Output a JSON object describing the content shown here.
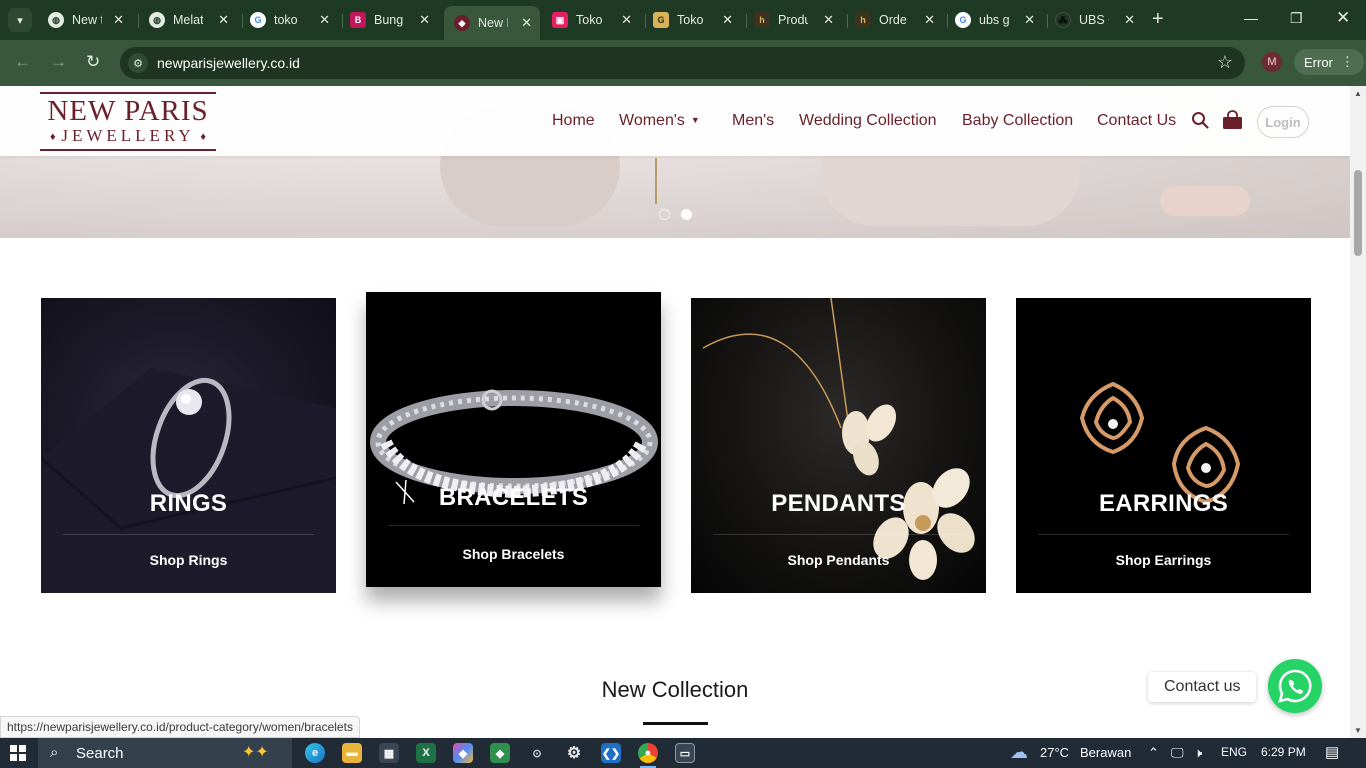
{
  "browser": {
    "tabs": [
      {
        "title": "New t",
        "favicon": "globe-icon",
        "fav_bg": "#e3ebe3",
        "fav_fg": "#1f3a24"
      },
      {
        "title": "Melat",
        "favicon": "globe-icon",
        "fav_bg": "#e3ebe3",
        "fav_fg": "#1f3a24"
      },
      {
        "title": "toko",
        "favicon": "google-icon",
        "fav_bg": "#ffffff",
        "fav_fg": "#4285f4"
      },
      {
        "title": "Bungi",
        "favicon": "bungi-icon",
        "fav_bg": "#c2185b",
        "fav_fg": "#ffffff"
      },
      {
        "title": "New P",
        "favicon": "newparis-icon",
        "fav_bg": "#6b1f2b",
        "fav_fg": "#ffffff"
      },
      {
        "title": "Toko",
        "favicon": "toko-pink-icon",
        "fav_bg": "#e91e63",
        "fav_fg": "#ffffff"
      },
      {
        "title": "Toko",
        "favicon": "toko-gold-icon",
        "fav_bg": "#d9b25a",
        "fav_fg": "#3a2a00"
      },
      {
        "title": "Produ",
        "favicon": "hala-gold-icon",
        "fav_bg": "#3b3320",
        "fav_fg": "#d9b25a"
      },
      {
        "title": "Orde",
        "favicon": "hala-gold-icon",
        "fav_bg": "#3b3320",
        "fav_fg": "#d9b25a"
      },
      {
        "title": "ubs g",
        "favicon": "google-icon",
        "fav_bg": "#ffffff",
        "fav_fg": "#4285f4"
      },
      {
        "title": "UBS C",
        "favicon": "ubs-icon",
        "fav_bg": "#1f3a24",
        "fav_fg": "#000000"
      }
    ],
    "active_tab_index": 4,
    "url": "newparisjewellery.co.id",
    "profile_initial": "M",
    "error_label": "Error"
  },
  "site": {
    "logo_line1": "NEW PARIS",
    "logo_line2": "JEWELLERY",
    "nav": {
      "home": "Home",
      "womens": "Women's",
      "mens": "Men's",
      "wedding": "Wedding Collection",
      "baby": "Baby Collection",
      "contact": "Contact Us"
    },
    "login": "Login",
    "slider_dots": 2,
    "slider_active": 2
  },
  "categories": [
    {
      "title": "RINGS",
      "link": "Shop Rings"
    },
    {
      "title": "BRACELETS",
      "link": "Shop Bracelets"
    },
    {
      "title": "PENDANTS",
      "link": "Shop Pendants"
    },
    {
      "title": "EARRINGS",
      "link": "Shop Earrings"
    }
  ],
  "section_title": "New Collection",
  "contact_us": "Contact us",
  "status_url": "https://newparisjewellery.co.id/product-category/women/bracelets",
  "taskbar": {
    "search": "Search",
    "weather_temp": "27°C",
    "weather_desc": "Berawan",
    "language": "ENG",
    "time": "6:29 PM"
  },
  "colors": {
    "brand": "#6b1f2b",
    "chrome_dark": "#1f3a24",
    "chrome_toolbar": "#38573b",
    "whatsapp": "#25d366",
    "taskbar": "#202b36"
  }
}
